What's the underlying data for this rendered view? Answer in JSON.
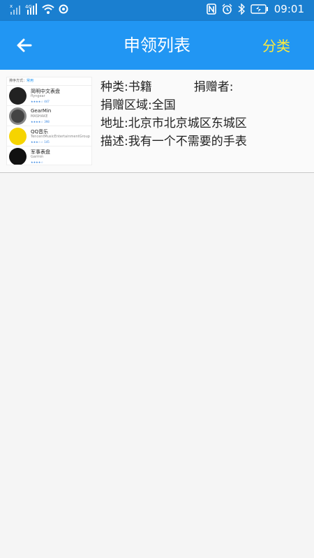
{
  "status_bar": {
    "left_icons": [
      "no-signal-icon",
      "4g-icon",
      "wifi-icon",
      "data-saver-icon"
    ],
    "net_label": "4G",
    "right_icons": [
      "nfc-icon",
      "alarm-icon",
      "bluetooth-icon",
      "battery-icon"
    ],
    "time": "09:01"
  },
  "app_bar": {
    "back_icon": "back-arrow-icon",
    "title": "申领列表",
    "category_label": "分类"
  },
  "items": [
    {
      "thumbnail": {
        "header_prefix": "排序方式：",
        "header_value": "常用",
        "apps": [
          {
            "name": "简明中文表盘",
            "sub": "flyngear",
            "stars": "★★★★☆ 447",
            "color": "#222"
          },
          {
            "name": "GearMin",
            "sub": "MASHAKE",
            "stars": "★★★★☆ 398",
            "color": "#333"
          },
          {
            "name": "QQ音乐",
            "sub": "TencentMusicEntertainmentGroup",
            "stars": "★★★☆☆ 145",
            "color": "#f6d400"
          },
          {
            "name": "军事表盘",
            "sub": "Garmin",
            "stars": "★★★★☆",
            "color": "#111"
          }
        ]
      },
      "type_label": "种类:",
      "type_value": "书籍",
      "donor_label": "捐赠者:",
      "donor_value": "",
      "region_label": "捐赠区域:",
      "region_value": "全国",
      "address_label": "地址:",
      "address_value": "北京市北京城区东城区",
      "desc_label": "描述:",
      "desc_value": "我有一个不需要的手表"
    }
  ]
}
